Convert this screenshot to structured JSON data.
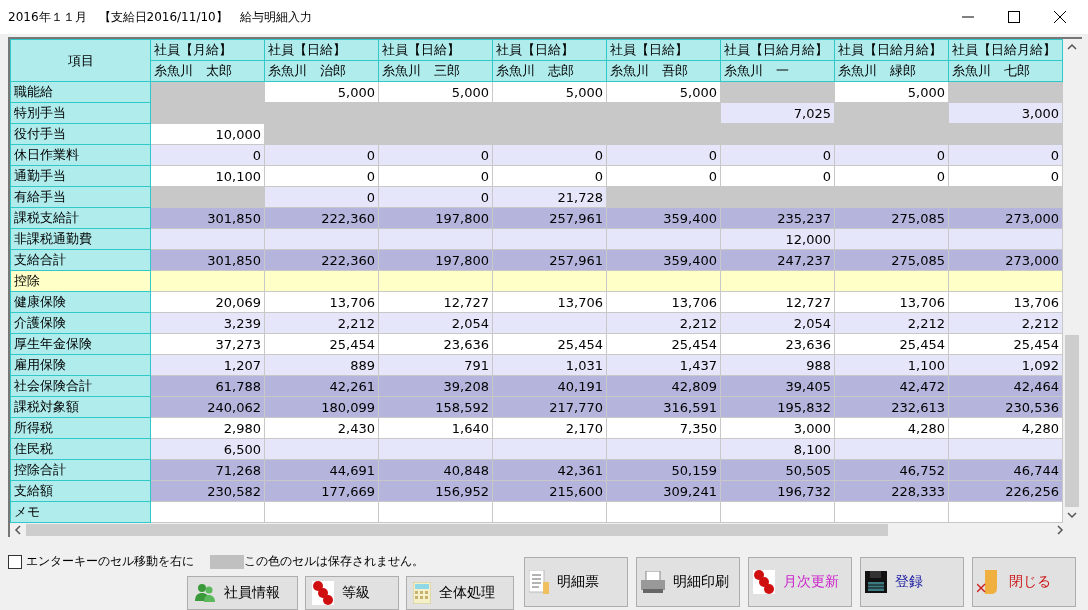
{
  "window": {
    "title": "2016年１１月　【支給日2016/11/10】　給与明細入力"
  },
  "table": {
    "corner": "項目",
    "columns": [
      {
        "type": "社員【月給】",
        "name": "糸魚川　太郎"
      },
      {
        "type": "社員【日給】",
        "name": "糸魚川　治郎"
      },
      {
        "type": "社員【日給】",
        "name": "糸魚川　三郎"
      },
      {
        "type": "社員【日給】",
        "name": "糸魚川　志郎"
      },
      {
        "type": "社員【日給】",
        "name": "糸魚川　吾郎"
      },
      {
        "type": "社員【日給月給】",
        "name": "糸魚川　一"
      },
      {
        "type": "社員【日給月給】",
        "name": "糸魚川　緑郎"
      },
      {
        "type": "社員【日給月給】",
        "name": "糸魚川　七郎"
      }
    ],
    "rows": [
      {
        "label": "職能給",
        "kind": "plain",
        "cells": [
          {
            "locked": true
          },
          {
            "value": "5,000",
            "locked": false
          },
          {
            "value": "5,000",
            "locked": false
          },
          {
            "value": "5,000",
            "locked": false
          },
          {
            "value": "5,000",
            "locked": false
          },
          {
            "locked": true
          },
          {
            "value": "5,000",
            "locked": false
          },
          {
            "locked": true
          }
        ]
      },
      {
        "label": "特別手当",
        "kind": "shaded",
        "cells": [
          {
            "locked": true
          },
          {
            "locked": true
          },
          {
            "locked": true
          },
          {
            "locked": true
          },
          {
            "locked": true
          },
          {
            "value": "7,025",
            "locked": false
          },
          {
            "locked": true
          },
          {
            "value": "3,000",
            "locked": false
          }
        ]
      },
      {
        "label": "役付手当",
        "kind": "plain",
        "cells": [
          {
            "value": "10,000",
            "locked": false
          },
          {
            "locked": true
          },
          {
            "locked": true
          },
          {
            "locked": true
          },
          {
            "locked": true
          },
          {
            "locked": true
          },
          {
            "locked": true
          },
          {
            "locked": true
          }
        ]
      },
      {
        "label": "休日作業料",
        "kind": "shaded",
        "cells": [
          {
            "value": "0",
            "locked": false
          },
          {
            "value": "0",
            "locked": false
          },
          {
            "value": "0",
            "locked": false
          },
          {
            "value": "0",
            "locked": false
          },
          {
            "value": "0",
            "locked": false
          },
          {
            "value": "0",
            "locked": false
          },
          {
            "value": "0",
            "locked": false
          },
          {
            "value": "0",
            "locked": false
          }
        ]
      },
      {
        "label": "通勤手当",
        "kind": "plain",
        "cells": [
          {
            "value": "10,100",
            "locked": false
          },
          {
            "value": "0",
            "locked": false
          },
          {
            "value": "0",
            "locked": false
          },
          {
            "value": "0",
            "locked": false
          },
          {
            "value": "0",
            "locked": false
          },
          {
            "value": "0",
            "locked": false
          },
          {
            "value": "0",
            "locked": false
          },
          {
            "value": "0",
            "locked": false
          }
        ]
      },
      {
        "label": "有給手当",
        "kind": "shaded",
        "cells": [
          {
            "locked": true
          },
          {
            "value": "0",
            "locked": false
          },
          {
            "value": "0",
            "locked": false
          },
          {
            "value": "21,728",
            "locked": false
          },
          {
            "locked": true
          },
          {
            "locked": true
          },
          {
            "locked": true
          },
          {
            "locked": true
          }
        ]
      },
      {
        "label": "課税支給計",
        "kind": "total",
        "cells": [
          {
            "value": "301,850",
            "locked": false
          },
          {
            "value": "222,360",
            "locked": false
          },
          {
            "value": "197,800",
            "locked": false
          },
          {
            "value": "257,961",
            "locked": false
          },
          {
            "value": "359,400",
            "locked": false
          },
          {
            "value": "235,237",
            "locked": false
          },
          {
            "value": "275,085",
            "locked": false
          },
          {
            "value": "273,000",
            "locked": false
          }
        ]
      },
      {
        "label": "非課税通勤費",
        "kind": "shaded",
        "cells": [
          {
            "locked": false
          },
          {
            "locked": false
          },
          {
            "locked": false
          },
          {
            "locked": false
          },
          {
            "locked": false
          },
          {
            "value": "12,000",
            "locked": false
          },
          {
            "locked": false
          },
          {
            "locked": false
          }
        ]
      },
      {
        "label": "支給合計",
        "kind": "total",
        "cells": [
          {
            "value": "301,850",
            "locked": false
          },
          {
            "value": "222,360",
            "locked": false
          },
          {
            "value": "197,800",
            "locked": false
          },
          {
            "value": "257,961",
            "locked": false
          },
          {
            "value": "359,400",
            "locked": false
          },
          {
            "value": "247,237",
            "locked": false
          },
          {
            "value": "275,085",
            "locked": false
          },
          {
            "value": "273,000",
            "locked": false
          }
        ]
      },
      {
        "label": "控除",
        "kind": "section"
      },
      {
        "label": "健康保険",
        "kind": "plain",
        "cells": [
          {
            "value": "20,069",
            "locked": false
          },
          {
            "value": "13,706",
            "locked": false
          },
          {
            "value": "12,727",
            "locked": false
          },
          {
            "value": "13,706",
            "locked": false
          },
          {
            "value": "13,706",
            "locked": false
          },
          {
            "value": "12,727",
            "locked": false
          },
          {
            "value": "13,706",
            "locked": false
          },
          {
            "value": "13,706",
            "locked": false
          }
        ]
      },
      {
        "label": "介護保険",
        "kind": "shaded",
        "cells": [
          {
            "value": "3,239",
            "locked": false
          },
          {
            "value": "2,212",
            "locked": false
          },
          {
            "value": "2,054",
            "locked": false
          },
          {
            "locked": false
          },
          {
            "value": "2,212",
            "locked": false
          },
          {
            "value": "2,054",
            "locked": false
          },
          {
            "value": "2,212",
            "locked": false
          },
          {
            "value": "2,212",
            "locked": false
          }
        ]
      },
      {
        "label": "厚生年金保険",
        "kind": "plain",
        "cells": [
          {
            "value": "37,273",
            "locked": false
          },
          {
            "value": "25,454",
            "locked": false
          },
          {
            "value": "23,636",
            "locked": false
          },
          {
            "value": "25,454",
            "locked": false
          },
          {
            "value": "25,454",
            "locked": false
          },
          {
            "value": "23,636",
            "locked": false
          },
          {
            "value": "25,454",
            "locked": false
          },
          {
            "value": "25,454",
            "locked": false
          }
        ]
      },
      {
        "label": "雇用保険",
        "kind": "shaded",
        "cells": [
          {
            "value": "1,207",
            "locked": false
          },
          {
            "value": "889",
            "locked": false
          },
          {
            "value": "791",
            "locked": false
          },
          {
            "value": "1,031",
            "locked": false
          },
          {
            "value": "1,437",
            "locked": false
          },
          {
            "value": "988",
            "locked": false
          },
          {
            "value": "1,100",
            "locked": false
          },
          {
            "value": "1,092",
            "locked": false
          }
        ]
      },
      {
        "label": "社会保険合計",
        "kind": "total",
        "cells": [
          {
            "value": "61,788",
            "locked": false
          },
          {
            "value": "42,261",
            "locked": false
          },
          {
            "value": "39,208",
            "locked": false
          },
          {
            "value": "40,191",
            "locked": false
          },
          {
            "value": "42,809",
            "locked": false
          },
          {
            "value": "39,405",
            "locked": false
          },
          {
            "value": "42,472",
            "locked": false
          },
          {
            "value": "42,464",
            "locked": false
          }
        ]
      },
      {
        "label": "課税対象額",
        "kind": "total",
        "cells": [
          {
            "value": "240,062",
            "locked": false
          },
          {
            "value": "180,099",
            "locked": false
          },
          {
            "value": "158,592",
            "locked": false
          },
          {
            "value": "217,770",
            "locked": false
          },
          {
            "value": "316,591",
            "locked": false
          },
          {
            "value": "195,832",
            "locked": false
          },
          {
            "value": "232,613",
            "locked": false
          },
          {
            "value": "230,536",
            "locked": false
          }
        ]
      },
      {
        "label": "所得税",
        "kind": "plain",
        "cells": [
          {
            "value": "2,980",
            "locked": false
          },
          {
            "value": "2,430",
            "locked": false
          },
          {
            "value": "1,640",
            "locked": false
          },
          {
            "value": "2,170",
            "locked": false
          },
          {
            "value": "7,350",
            "locked": false
          },
          {
            "value": "3,000",
            "locked": false
          },
          {
            "value": "4,280",
            "locked": false
          },
          {
            "value": "4,280",
            "locked": false
          }
        ]
      },
      {
        "label": "住民税",
        "kind": "shaded",
        "cells": [
          {
            "value": "6,500",
            "locked": false
          },
          {
            "locked": false
          },
          {
            "locked": false
          },
          {
            "locked": false
          },
          {
            "locked": false
          },
          {
            "value": "8,100",
            "locked": false
          },
          {
            "locked": false
          },
          {
            "locked": false
          }
        ]
      },
      {
        "label": "控除合計",
        "kind": "total",
        "cells": [
          {
            "value": "71,268",
            "locked": false
          },
          {
            "value": "44,691",
            "locked": false
          },
          {
            "value": "40,848",
            "locked": false
          },
          {
            "value": "42,361",
            "locked": false
          },
          {
            "value": "50,159",
            "locked": false
          },
          {
            "value": "50,505",
            "locked": false
          },
          {
            "value": "46,752",
            "locked": false
          },
          {
            "value": "46,744",
            "locked": false
          }
        ]
      },
      {
        "label": "支給額",
        "kind": "total",
        "cells": [
          {
            "value": "230,582",
            "locked": false
          },
          {
            "value": "177,669",
            "locked": false
          },
          {
            "value": "156,952",
            "locked": false
          },
          {
            "value": "215,600",
            "locked": false
          },
          {
            "value": "309,241",
            "locked": false
          },
          {
            "value": "196,732",
            "locked": false
          },
          {
            "value": "228,333",
            "locked": false
          },
          {
            "value": "226,256",
            "locked": false
          }
        ]
      },
      {
        "label": "メモ",
        "kind": "plain",
        "cells": [
          {
            "locked": false
          },
          {
            "locked": false
          },
          {
            "locked": false
          },
          {
            "locked": false
          },
          {
            "locked": false
          },
          {
            "locked": false
          },
          {
            "locked": false
          },
          {
            "locked": false
          }
        ]
      }
    ]
  },
  "options": {
    "enter_right": {
      "label": "エンターキーのセル移動を右に",
      "checked": false
    },
    "legend": "この色のセルは保存されません。"
  },
  "small_buttons": [
    {
      "label": "社員情報",
      "kind": "people",
      "color": "#000000"
    },
    {
      "label": "等級",
      "kind": "numbers",
      "color": "#000000"
    },
    {
      "label": "全体処理",
      "kind": "calculator",
      "color": "#000000"
    }
  ],
  "buttons": [
    {
      "label": "明細票",
      "kind": "document",
      "color": "#000000"
    },
    {
      "label": "明細印刷",
      "kind": "printer",
      "color": "#000000"
    },
    {
      "label": "月次更新",
      "kind": "numbers",
      "color": "#cc22cc"
    },
    {
      "label": "登録",
      "kind": "floppy",
      "color": "#1a1aa0"
    },
    {
      "label": "閉じる",
      "kind": "exit",
      "color": "#cc1a1a"
    }
  ]
}
